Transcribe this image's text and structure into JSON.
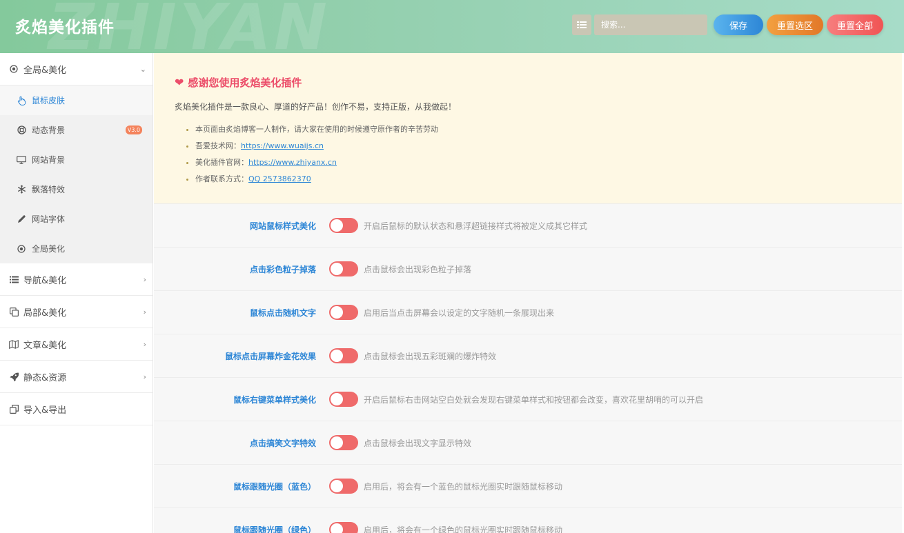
{
  "header": {
    "watermark": "ZHIYAN",
    "title": "炙焰美化插件",
    "search_placeholder": "搜索...",
    "save_label": "保存",
    "reset_section_label": "重置选区",
    "reset_all_label": "重置全部"
  },
  "sidebar": {
    "sections": [
      {
        "label": "全局&美化",
        "icon": "circle-dot-icon",
        "expanded": true
      },
      {
        "label": "导航&美化",
        "icon": "list-icon"
      },
      {
        "label": "局部&美化",
        "icon": "copy-icon"
      },
      {
        "label": "文章&美化",
        "icon": "map-icon"
      },
      {
        "label": "静态&资源",
        "icon": "rocket-icon"
      },
      {
        "label": "导入&导出",
        "icon": "copy-icon"
      }
    ],
    "subitems": [
      {
        "label": "鼠标皮肤",
        "icon": "hand-pointer-icon",
        "active": true
      },
      {
        "label": "动态背景",
        "icon": "life-ring-icon",
        "badge": "V3.0"
      },
      {
        "label": "网站背景",
        "icon": "monitor-icon"
      },
      {
        "label": "飘落特效",
        "icon": "snowflake-icon"
      },
      {
        "label": "网站字体",
        "icon": "pencil-icon"
      },
      {
        "label": "全局美化",
        "icon": "circle-dot-icon"
      }
    ]
  },
  "notice": {
    "title": "感谢您使用炙焰美化插件",
    "intro": "炙焰美化插件是一款良心、厚道的好产品！创作不易，支持正版，从我做起！",
    "items": [
      {
        "text": "本页面由炙焰博客一人制作，请大家在使用的时候遵守原作者的辛苦劳动",
        "link": ""
      },
      {
        "text": "吾爱技术网：",
        "link": "https://www.wuaijs.cn"
      },
      {
        "text": "美化插件官网：",
        "link": "https://www.zhiyanx.cn"
      },
      {
        "text": "作者联系方式：",
        "link": "QQ 2573862370"
      }
    ]
  },
  "settings": [
    {
      "label": "网站鼠标样式美化",
      "desc": "开启后鼠标的默认状态和悬浮超链接样式将被定义成其它样式"
    },
    {
      "label": "点击彩色粒子掉落",
      "desc": "点击鼠标会出现彩色粒子掉落"
    },
    {
      "label": "鼠标点击随机文字",
      "desc": "启用后当点击屏幕会以设定的文字随机一条展现出来"
    },
    {
      "label": "鼠标点击屏幕炸金花效果",
      "desc": "点击鼠标会出现五彩斑斓的爆炸特效"
    },
    {
      "label": "鼠标右键菜单样式美化",
      "desc": "开启后鼠标右击网站空白处就会发现右键菜单样式和按钮都会改变，喜欢花里胡哨的可以开启"
    },
    {
      "label": "点击搞笑文字特效",
      "desc": "点击鼠标会出现文字显示特效"
    },
    {
      "label": "鼠标跟随光圈（蓝色）",
      "desc": "启用后，将会有一个蓝色的鼠标光圈实时跟随鼠标移动"
    },
    {
      "label": "鼠标跟随光圈（绿色）",
      "desc": "启用后，将会有一个绿色的鼠标光圈实时跟随鼠标移动"
    }
  ],
  "colors": {
    "accent_blue": "#2d86d6",
    "toggle_off": "#ef6a6a",
    "notice_title": "#ec4e6a"
  }
}
